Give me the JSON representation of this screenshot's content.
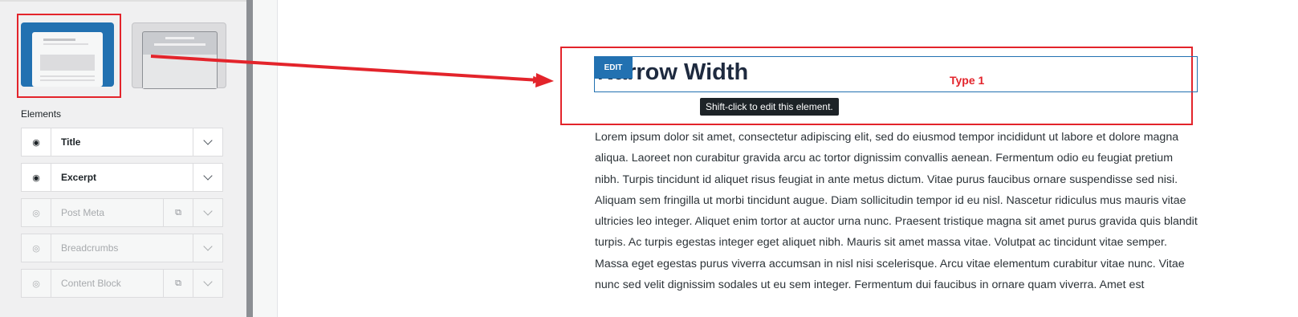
{
  "sidebar": {
    "elements_heading": "Elements",
    "layouts": [
      {
        "name": "layout-narrow",
        "selected": true
      },
      {
        "name": "layout-wide",
        "selected": false
      }
    ],
    "elements": [
      {
        "label": "Title",
        "visible": true,
        "icon": "eye-icon"
      },
      {
        "label": "Excerpt",
        "visible": true,
        "icon": "eye-icon"
      },
      {
        "label": "Post Meta",
        "visible": false,
        "icon": "eye-slash-icon",
        "has_copy": true
      },
      {
        "label": "Breadcrumbs",
        "visible": false,
        "icon": "eye-slash-icon"
      },
      {
        "label": "Content Block",
        "visible": false,
        "icon": "eye-slash-icon",
        "has_copy": true
      }
    ]
  },
  "preview": {
    "edit_badge": "EDIT",
    "title": "Narrow Width",
    "tooltip": "Shift-click to edit this element.",
    "annotation": "Type 1",
    "excerpt": "Lorem ipsum dolor sit amet, consectetur adipiscing elit, sed do eiusmod tempor incididunt ut labore et dolore magna aliqua. Laoreet non curabitur gravida arcu ac tortor dignissim convallis aenean. Fermentum odio eu feugiat pretium nibh. Turpis tincidunt id aliquet risus feugiat in ante metus dictum. Vitae purus faucibus ornare suspendisse sed nisi. Aliquam sem fringilla ut morbi tincidunt augue. Diam sollicitudin tempor id eu nisl. Nascetur ridiculus mus mauris vitae ultricies leo integer. Aliquet enim tortor at auctor urna nunc. Praesent tristique magna sit amet purus gravida quis blandit turpis. Ac turpis egestas integer eget aliquet nibh. Mauris sit amet massa vitae. Volutpat ac tincidunt vitae semper. Massa eget egestas purus viverra accumsan in nisl nisi scelerisque. Arcu vitae elementum curabitur vitae nunc. Vitae nunc sed velit dignissim sodales ut eu sem integer. Fermentum dui faucibus in ornare quam viverra. Amet est"
  },
  "colors": {
    "accent": "#2271b1",
    "annotation_red": "#e3242b",
    "tooltip_bg": "#1d2327"
  }
}
